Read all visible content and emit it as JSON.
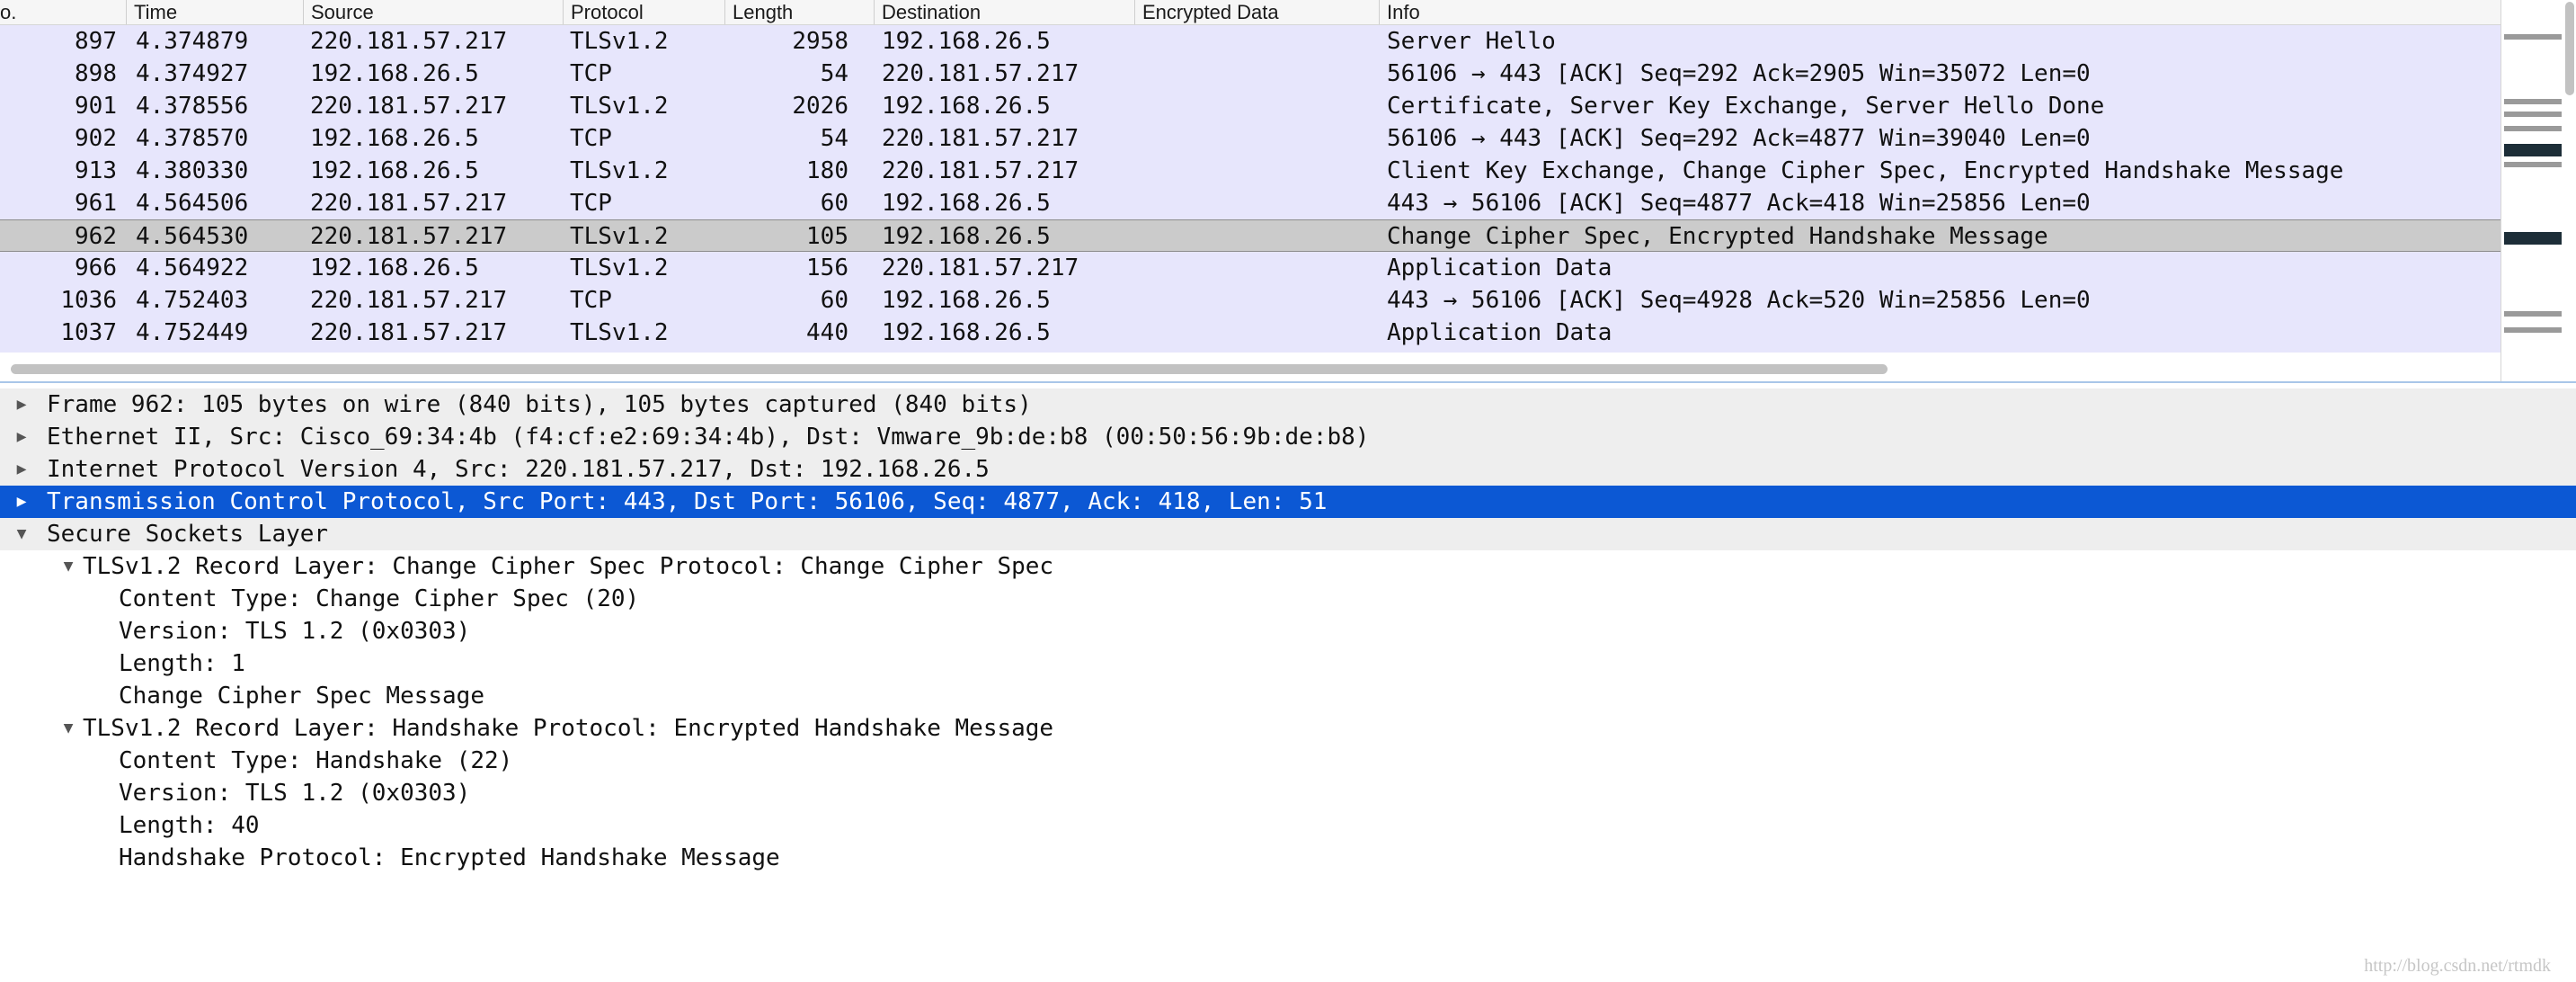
{
  "columns": {
    "no": "o.",
    "time": "Time",
    "source": "Source",
    "protocol": "Protocol",
    "length": "Length",
    "destination": "Destination",
    "encrypted": "Encrypted Data",
    "info": "Info"
  },
  "packets": [
    {
      "no": "897",
      "time": "4.374879",
      "source": "220.181.57.217",
      "protocol": "TLSv1.2",
      "length": "2958",
      "destination": "192.168.26.5",
      "info": "Server Hello"
    },
    {
      "no": "898",
      "time": "4.374927",
      "source": "192.168.26.5",
      "protocol": "TCP",
      "length": "54",
      "destination": "220.181.57.217",
      "info": "56106 → 443 [ACK] Seq=292 Ack=2905 Win=35072 Len=0"
    },
    {
      "no": "901",
      "time": "4.378556",
      "source": "220.181.57.217",
      "protocol": "TLSv1.2",
      "length": "2026",
      "destination": "192.168.26.5",
      "info": "Certificate, Server Key Exchange, Server Hello Done"
    },
    {
      "no": "902",
      "time": "4.378570",
      "source": "192.168.26.5",
      "protocol": "TCP",
      "length": "54",
      "destination": "220.181.57.217",
      "info": "56106 → 443 [ACK] Seq=292 Ack=4877 Win=39040 Len=0"
    },
    {
      "no": "913",
      "time": "4.380330",
      "source": "192.168.26.5",
      "protocol": "TLSv1.2",
      "length": "180",
      "destination": "220.181.57.217",
      "info": "Client Key Exchange, Change Cipher Spec, Encrypted Handshake Message"
    },
    {
      "no": "961",
      "time": "4.564506",
      "source": "220.181.57.217",
      "protocol": "TCP",
      "length": "60",
      "destination": "192.168.26.5",
      "info": "443 → 56106 [ACK] Seq=4877 Ack=418 Win=25856 Len=0"
    },
    {
      "no": "962",
      "time": "4.564530",
      "source": "220.181.57.217",
      "protocol": "TLSv1.2",
      "length": "105",
      "destination": "192.168.26.5",
      "info": "Change Cipher Spec, Encrypted Handshake Message"
    },
    {
      "no": "966",
      "time": "4.564922",
      "source": "192.168.26.5",
      "protocol": "TLSv1.2",
      "length": "156",
      "destination": "220.181.57.217",
      "info": "Application Data"
    },
    {
      "no": "1036",
      "time": "4.752403",
      "source": "220.181.57.217",
      "protocol": "TCP",
      "length": "60",
      "destination": "192.168.26.5",
      "info": "443 → 56106 [ACK] Seq=4928 Ack=520 Win=25856 Len=0"
    },
    {
      "no": "1037",
      "time": "4.752449",
      "source": "220.181.57.217",
      "protocol": "TLSv1.2",
      "length": "440",
      "destination": "192.168.26.5",
      "info": "Application Data"
    }
  ],
  "selected_packet": "962",
  "details": [
    {
      "text": "Frame 962: 105 bytes on wire (840 bits), 105 bytes captured (840 bits)",
      "expanded": false
    },
    {
      "text": "Ethernet II, Src: Cisco_69:34:4b (f4:cf:e2:69:34:4b), Dst: Vmware_9b:de:b8 (00:50:56:9b:de:b8)",
      "expanded": false
    },
    {
      "text": "Internet Protocol Version 4, Src: 220.181.57.217, Dst: 192.168.26.5",
      "expanded": false
    },
    {
      "text": "Transmission Control Protocol, Src Port: 443, Dst Port: 56106, Seq: 4877, Ack: 418, Len: 51",
      "expanded": false,
      "selected": true
    },
    {
      "text": "Secure Sockets Layer",
      "expanded": true
    },
    {
      "text": "TLSv1.2 Record Layer: Change Cipher Spec Protocol: Change Cipher Spec",
      "expanded": true
    },
    {
      "text": "Content Type: Change Cipher Spec (20)"
    },
    {
      "text": "Version: TLS 1.2 (0x0303)"
    },
    {
      "text": "Length: 1"
    },
    {
      "text": "Change Cipher Spec Message"
    },
    {
      "text": "TLSv1.2 Record Layer: Handshake Protocol: Encrypted Handshake Message",
      "expanded": true
    },
    {
      "text": "Content Type: Handshake (22)"
    },
    {
      "text": "Version: TLS 1.2 (0x0303)"
    },
    {
      "text": "Length: 40"
    },
    {
      "text": "Handshake Protocol: Encrypted Handshake Message"
    }
  ],
  "icons": {
    "collapsed": "disclosure-triangle-right-icon",
    "expanded": "disclosure-triangle-down-icon"
  },
  "glyphs": {
    "collapsed": "▶",
    "expanded": "▼"
  },
  "watermark": "http://blog.csdn.net/rtmdk",
  "colors": {
    "row_background": "#e7e6fc",
    "selected_row": "#cbcbcb",
    "selected_tree_item": "#0c58d4",
    "tree_group_background": "#eeeeee"
  }
}
